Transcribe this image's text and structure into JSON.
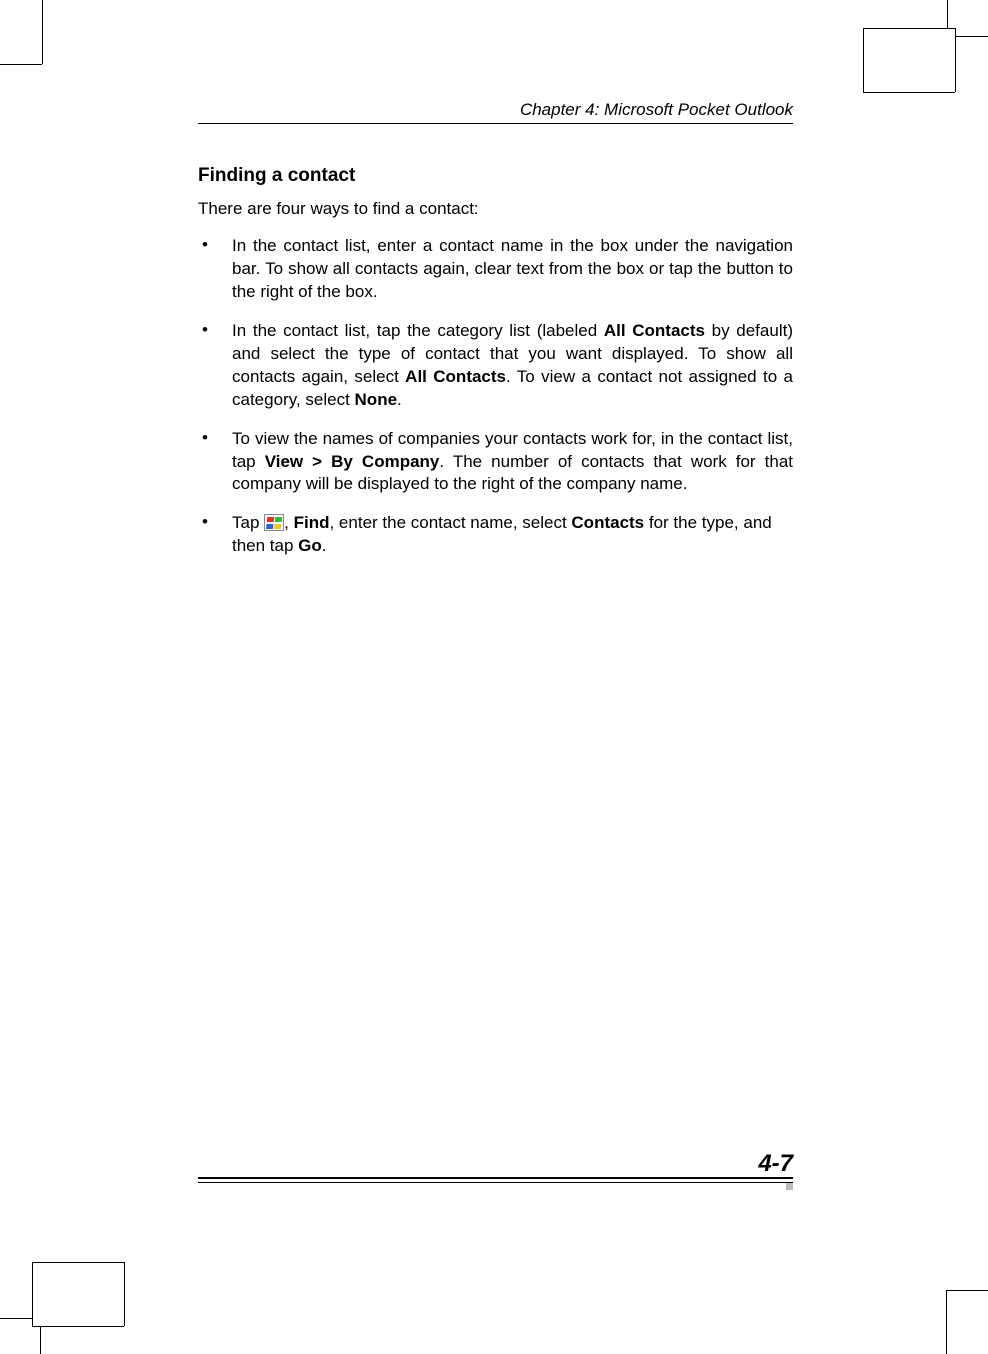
{
  "header": {
    "chapter": "Chapter 4: Microsoft Pocket Outlook"
  },
  "section": {
    "heading": "Finding a contact",
    "intro": "There are four ways to find a contact:"
  },
  "bullets": {
    "b1": {
      "pre": "In the contact list, enter a contact name in the box under the naviga­tion bar. To show all contacts again, clear text from the box or tap the button to the right of the box."
    },
    "b2": {
      "p1": "In the contact list, tap the category list (labeled ",
      "bold1": "All Contacts",
      "p2": " by de­fault) and select the type of contact that you want displayed. To show all contacts again, select ",
      "bold2": "All Contacts",
      "p3": ". To view a contact not as­signed to a category, select ",
      "bold3": "None",
      "p4": "."
    },
    "b3": {
      "p1": "To view the names of companies your contacts work for, in the contact list, tap ",
      "bold1": "View",
      "sep": " > ",
      "bold2": "By Company",
      "p2": ". The number of contacts that work for that company will be displayed to the right of the company name."
    },
    "b4": {
      "p1": "Tap ",
      "p2": ", ",
      "bold1": "Find",
      "p3": ", enter the contact name, select ",
      "bold2": "Contacts",
      "p4": " for the type, and then tap ",
      "bold3": "Go",
      "p5": "."
    }
  },
  "footer": {
    "page": "4-7"
  }
}
